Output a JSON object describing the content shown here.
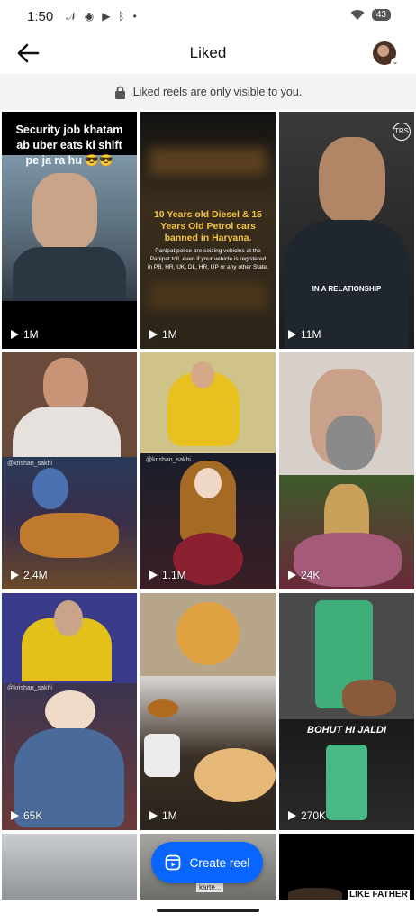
{
  "status_bar": {
    "time": "1:50",
    "battery": "43"
  },
  "header": {
    "title": "Liked"
  },
  "notice": {
    "text": "Liked reels are only visible to you."
  },
  "reels": [
    {
      "views": "1M",
      "caption": "Security job khatam ab uber eats ki shift pe ja ra hu 😎😎"
    },
    {
      "views": "1M",
      "caption": "10 Years old Diesel & 15 Years Old Petrol cars banned in Haryana.",
      "subcaption": "Panipat police are seizing vehicles at the Panipat toll, even if your vehicle is registered in PB, HR, UK, DL, HR, UP or any other State."
    },
    {
      "views": "11M",
      "caption": "IN A RELATIONSHIP",
      "badge": "TRS"
    },
    {
      "views": "2.4M",
      "tag": "@krishan_sakhi"
    },
    {
      "views": "1.1M",
      "tag": "@krishan_sakhi"
    },
    {
      "views": "24K"
    },
    {
      "views": "65K",
      "tag": "@krishan_sakhi"
    },
    {
      "views": "1M"
    },
    {
      "views": "270K",
      "caption": "BOHUT HI JALDI"
    },
    {
      "views": ""
    },
    {
      "views": "",
      "tag": "karte..."
    },
    {
      "views": "",
      "caption": "LIKE FATHER"
    }
  ],
  "fab": {
    "label": "Create reel"
  }
}
